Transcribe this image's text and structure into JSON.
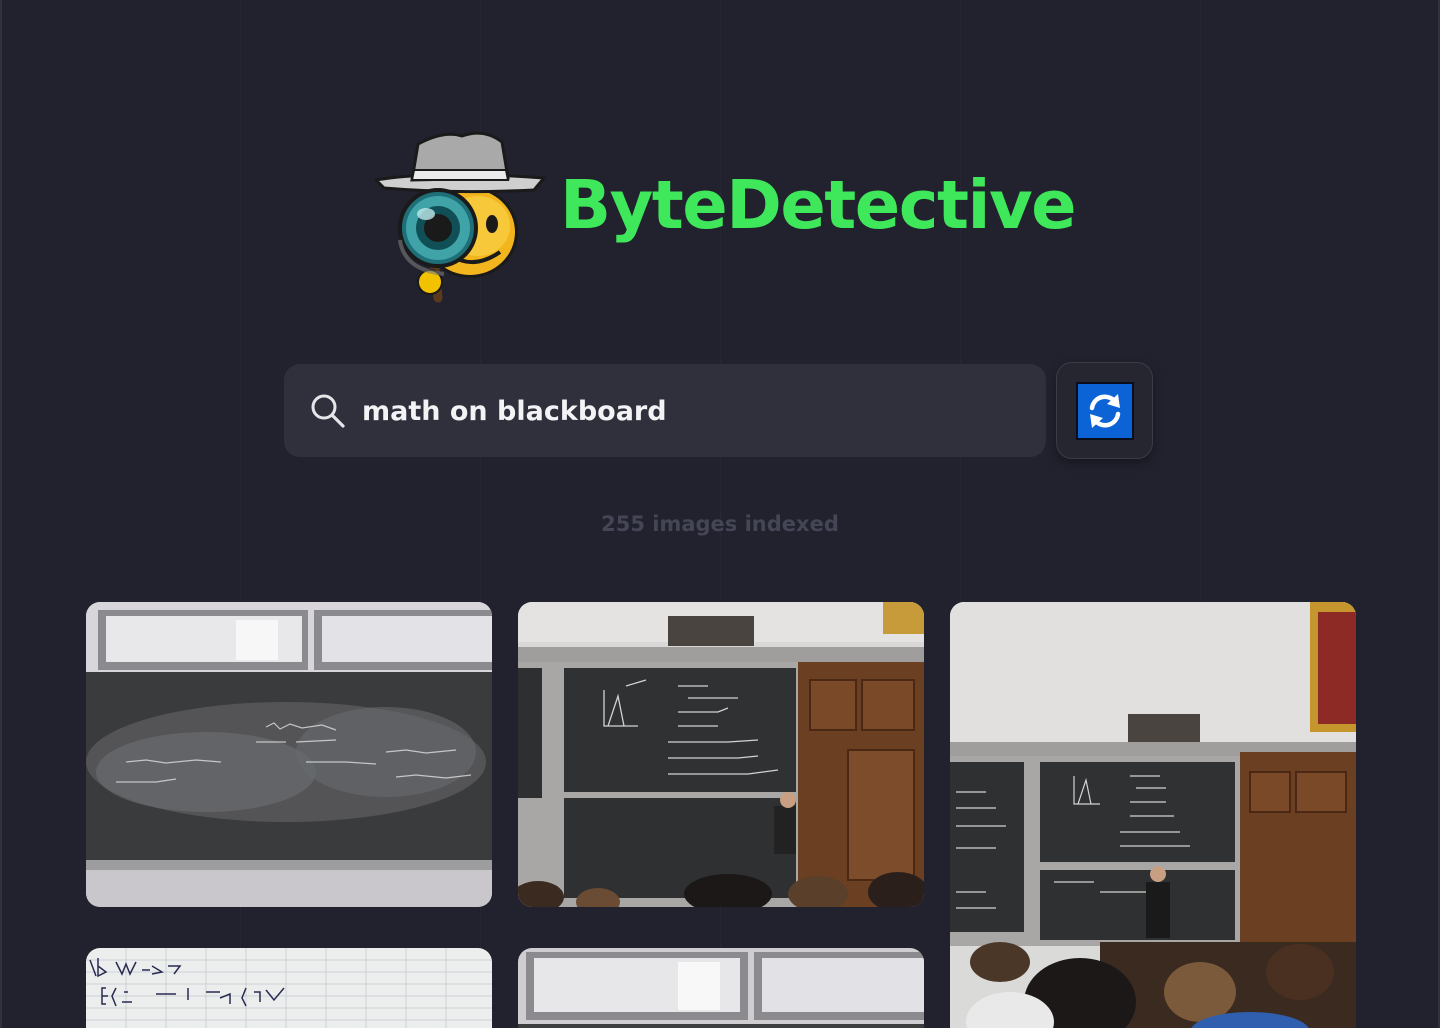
{
  "brand": {
    "title": "ByteDetective",
    "logo_icon": "detective-emoji-icon",
    "title_color": "#3ee85a"
  },
  "search": {
    "query": "math on blackboard",
    "placeholder": "",
    "icon": "search-icon"
  },
  "refresh": {
    "icon": "refresh-icon",
    "color": "#0b63d6"
  },
  "status": {
    "indexed_text": "255 images indexed"
  },
  "results": [
    {
      "thumbnail": "blackboard-closeup-image"
    },
    {
      "thumbnail": "lecture-hall-blackboard-image"
    },
    {
      "thumbnail": "lecture-hall-wide-image"
    },
    {
      "thumbnail": "handwritten-notes-image"
    },
    {
      "thumbnail": "blackboard-lights-image"
    }
  ],
  "colors": {
    "background": "#21222e",
    "search_bg": "#2f303c",
    "status_text": "#454655"
  }
}
